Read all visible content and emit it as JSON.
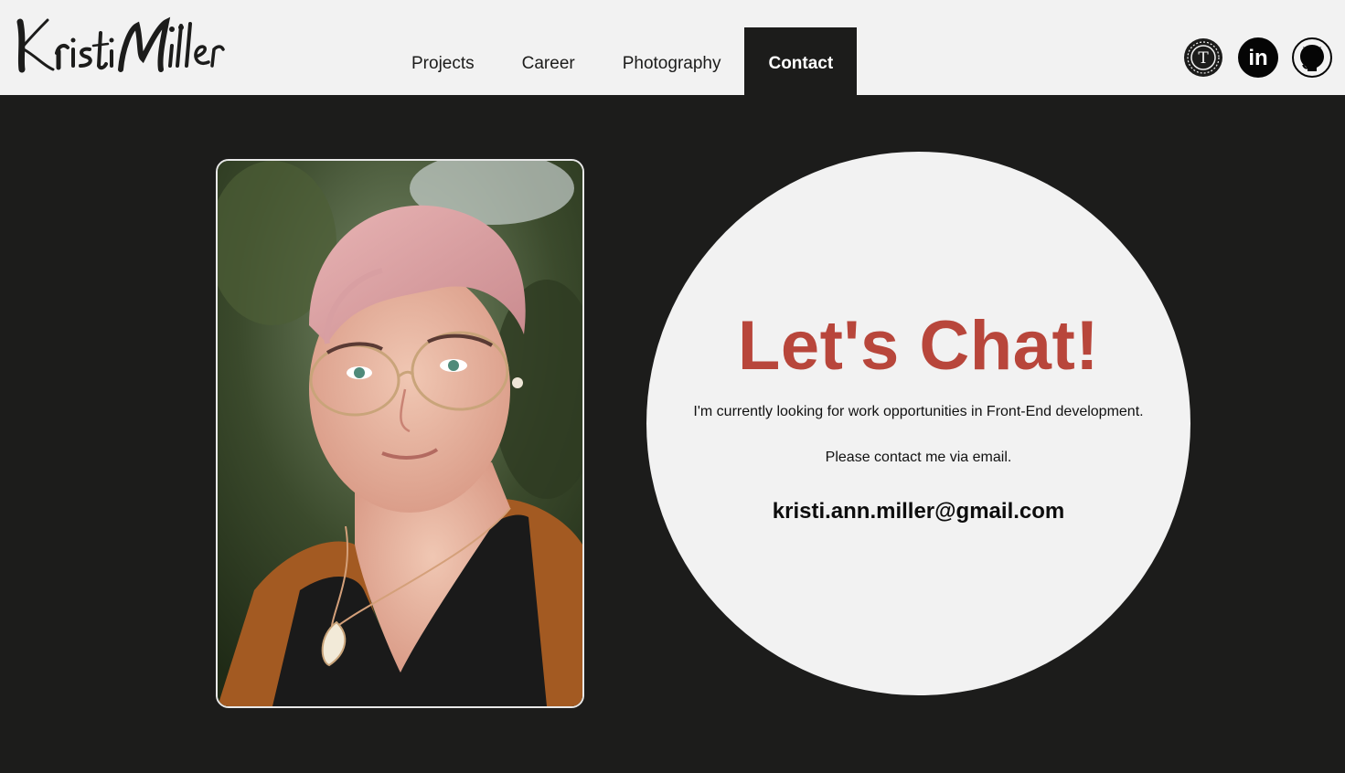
{
  "site": {
    "logo_text": "Kristi Miller"
  },
  "nav": {
    "items": [
      {
        "label": "Projects"
      },
      {
        "label": "Career"
      },
      {
        "label": "Photography"
      },
      {
        "label": "Contact"
      }
    ],
    "active": "Contact"
  },
  "social": {
    "icons": [
      "typography-icon",
      "linkedin-icon",
      "github-icon"
    ],
    "typography_letter": "T",
    "linkedin_letter": "in"
  },
  "contact": {
    "headline": "Let's Chat!",
    "line1": "I'm currently looking for work opportunities in Front-End development.",
    "line2": "Please contact me via email.",
    "email": "kristi.ann.miller@gmail.com"
  },
  "colors": {
    "header_bg": "#f2f2f2",
    "page_bg": "#1c1c1b",
    "accent": "#b8463b",
    "circle_bg": "#f2f2f2"
  }
}
